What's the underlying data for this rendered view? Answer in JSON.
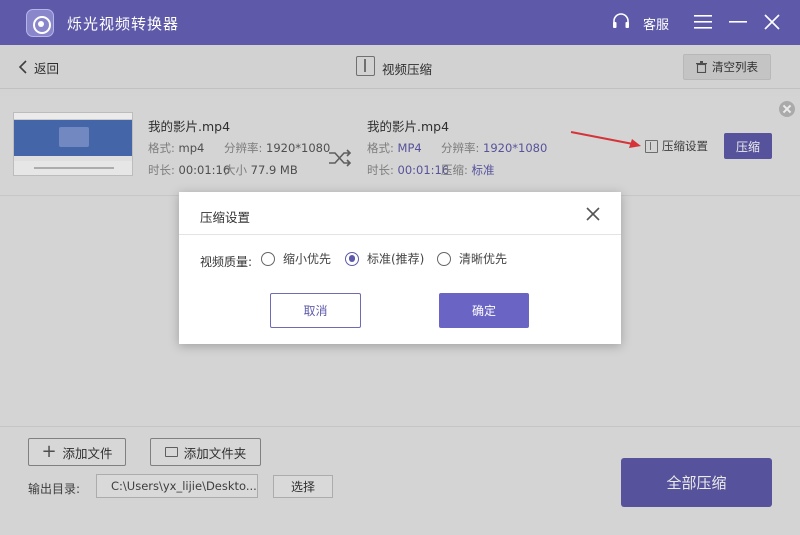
{
  "app": {
    "title": "烁光视频转换器",
    "service_label": "客服"
  },
  "toolbar": {
    "back_label": "返回",
    "mode_title": "视频压缩",
    "clear_label": "清空列表"
  },
  "file": {
    "source": {
      "name": "我的影片.mp4",
      "format_label": "格式:",
      "format": "mp4",
      "resolution_label": "分辨率:",
      "resolution": "1920*1080",
      "duration_label": "时长:",
      "duration": "00:01:16",
      "size_label": "大小",
      "size": "77.9 MB"
    },
    "output": {
      "name": "我的影片.mp4",
      "format_label": "格式:",
      "format": "MP4",
      "resolution_label": "分辨率:",
      "resolution": "1920*1080",
      "duration_label": "时长:",
      "duration": "00:01:16",
      "compress_label": "压缩:",
      "compress_level": "标准"
    },
    "settings_label": "压缩设置",
    "compress_button": "压缩"
  },
  "bottom": {
    "add_file": "添加文件",
    "add_folder": "添加文件夹",
    "output_label": "输出目录:",
    "output_path": "C:\\Users\\yx_lijie\\Deskto...",
    "browse": "选择",
    "compress_all": "全部压缩"
  },
  "modal": {
    "title": "压缩设置",
    "quality_label": "视频质量:",
    "options": [
      {
        "label": "缩小优先",
        "checked": false
      },
      {
        "label": "标准(推荐)",
        "checked": true
      },
      {
        "label": "清晰优先",
        "checked": false
      }
    ],
    "cancel": "取消",
    "confirm": "确定"
  },
  "colors": {
    "accent": "#5e5aa9",
    "annotation_arrow": "#e8383d"
  }
}
